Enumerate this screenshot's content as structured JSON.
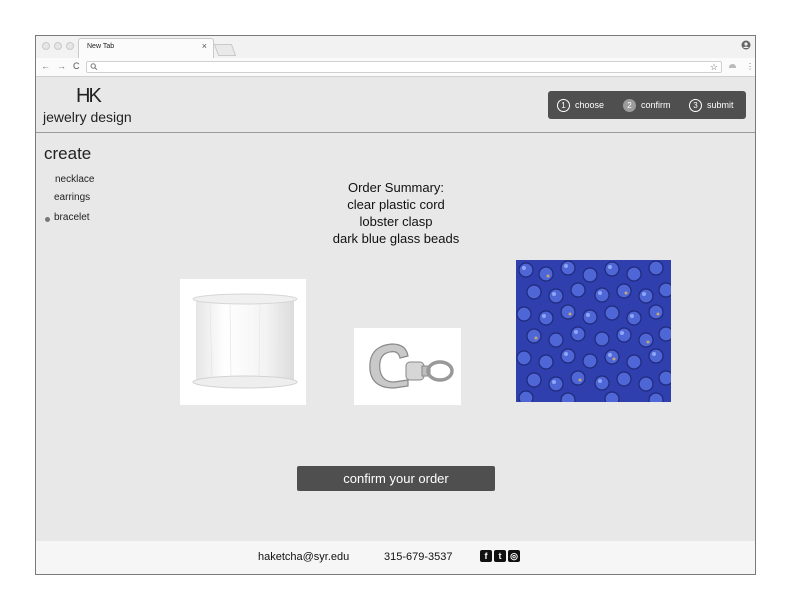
{
  "browser": {
    "tab_title": "New Tab",
    "tab_close": "×",
    "profile_icon": "profile-icon",
    "back_icon": "←",
    "forward_icon": "→",
    "reload_icon": "C",
    "search_icon": "⚲",
    "star_icon": "☆",
    "menu_icon": "⋮"
  },
  "header": {
    "logo_mark": "HK",
    "logo_text": "jewelry design",
    "steps": [
      {
        "num": "1",
        "label": "choose",
        "active": false
      },
      {
        "num": "2",
        "label": "confirm",
        "active": true
      },
      {
        "num": "3",
        "label": "submit",
        "active": false
      }
    ]
  },
  "sidebar": {
    "title": "create",
    "items": [
      {
        "label": "necklace",
        "selected": false
      },
      {
        "label": "earrings",
        "selected": false
      },
      {
        "label": "bracelet",
        "selected": true
      }
    ]
  },
  "summary": {
    "title": "Order Summary:",
    "items": [
      "clear plastic cord",
      "lobster clasp",
      "dark blue glass beads"
    ]
  },
  "confirm_button": "confirm your order",
  "footer": {
    "email": "haketcha@syr.edu",
    "phone": "315-679-3537",
    "social": [
      {
        "name": "facebook-icon",
        "glyph": "f"
      },
      {
        "name": "twitter-icon",
        "glyph": "t"
      },
      {
        "name": "instagram-icon",
        "glyph": "◎"
      }
    ]
  },
  "colors": {
    "page_bg": "#e8e8e8",
    "button_bg": "#4f4f4f",
    "active_step": "#9c9c9c",
    "bead_blue": "#3646b9"
  }
}
